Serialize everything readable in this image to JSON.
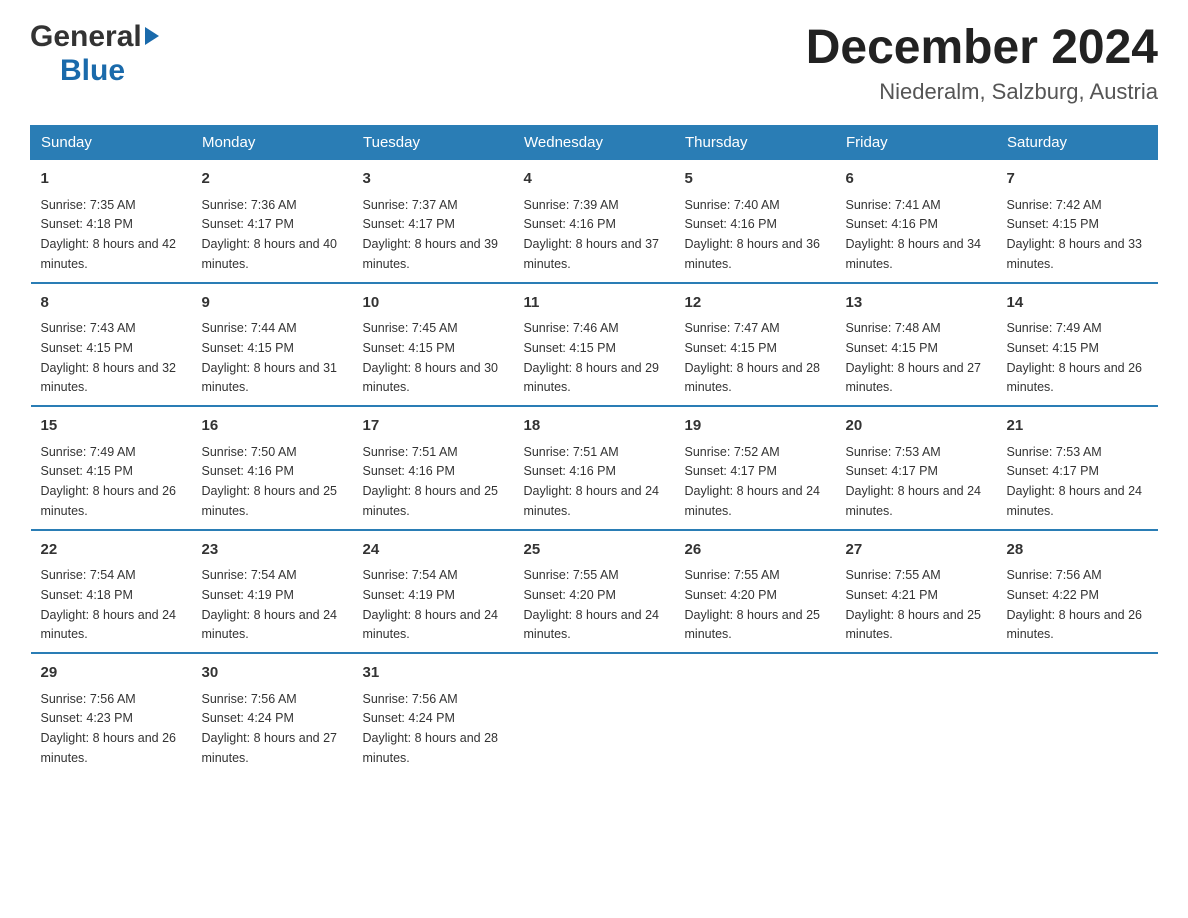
{
  "logo": {
    "general": "General",
    "blue": "Blue",
    "arrow_color": "#1a6aab"
  },
  "header": {
    "month_title": "December 2024",
    "location": "Niederalm, Salzburg, Austria"
  },
  "weekdays": [
    "Sunday",
    "Monday",
    "Tuesday",
    "Wednesday",
    "Thursday",
    "Friday",
    "Saturday"
  ],
  "weeks": [
    [
      {
        "day": "1",
        "sunrise": "Sunrise: 7:35 AM",
        "sunset": "Sunset: 4:18 PM",
        "daylight": "Daylight: 8 hours and 42 minutes."
      },
      {
        "day": "2",
        "sunrise": "Sunrise: 7:36 AM",
        "sunset": "Sunset: 4:17 PM",
        "daylight": "Daylight: 8 hours and 40 minutes."
      },
      {
        "day": "3",
        "sunrise": "Sunrise: 7:37 AM",
        "sunset": "Sunset: 4:17 PM",
        "daylight": "Daylight: 8 hours and 39 minutes."
      },
      {
        "day": "4",
        "sunrise": "Sunrise: 7:39 AM",
        "sunset": "Sunset: 4:16 PM",
        "daylight": "Daylight: 8 hours and 37 minutes."
      },
      {
        "day": "5",
        "sunrise": "Sunrise: 7:40 AM",
        "sunset": "Sunset: 4:16 PM",
        "daylight": "Daylight: 8 hours and 36 minutes."
      },
      {
        "day": "6",
        "sunrise": "Sunrise: 7:41 AM",
        "sunset": "Sunset: 4:16 PM",
        "daylight": "Daylight: 8 hours and 34 minutes."
      },
      {
        "day": "7",
        "sunrise": "Sunrise: 7:42 AM",
        "sunset": "Sunset: 4:15 PM",
        "daylight": "Daylight: 8 hours and 33 minutes."
      }
    ],
    [
      {
        "day": "8",
        "sunrise": "Sunrise: 7:43 AM",
        "sunset": "Sunset: 4:15 PM",
        "daylight": "Daylight: 8 hours and 32 minutes."
      },
      {
        "day": "9",
        "sunrise": "Sunrise: 7:44 AM",
        "sunset": "Sunset: 4:15 PM",
        "daylight": "Daylight: 8 hours and 31 minutes."
      },
      {
        "day": "10",
        "sunrise": "Sunrise: 7:45 AM",
        "sunset": "Sunset: 4:15 PM",
        "daylight": "Daylight: 8 hours and 30 minutes."
      },
      {
        "day": "11",
        "sunrise": "Sunrise: 7:46 AM",
        "sunset": "Sunset: 4:15 PM",
        "daylight": "Daylight: 8 hours and 29 minutes."
      },
      {
        "day": "12",
        "sunrise": "Sunrise: 7:47 AM",
        "sunset": "Sunset: 4:15 PM",
        "daylight": "Daylight: 8 hours and 28 minutes."
      },
      {
        "day": "13",
        "sunrise": "Sunrise: 7:48 AM",
        "sunset": "Sunset: 4:15 PM",
        "daylight": "Daylight: 8 hours and 27 minutes."
      },
      {
        "day": "14",
        "sunrise": "Sunrise: 7:49 AM",
        "sunset": "Sunset: 4:15 PM",
        "daylight": "Daylight: 8 hours and 26 minutes."
      }
    ],
    [
      {
        "day": "15",
        "sunrise": "Sunrise: 7:49 AM",
        "sunset": "Sunset: 4:15 PM",
        "daylight": "Daylight: 8 hours and 26 minutes."
      },
      {
        "day": "16",
        "sunrise": "Sunrise: 7:50 AM",
        "sunset": "Sunset: 4:16 PM",
        "daylight": "Daylight: 8 hours and 25 minutes."
      },
      {
        "day": "17",
        "sunrise": "Sunrise: 7:51 AM",
        "sunset": "Sunset: 4:16 PM",
        "daylight": "Daylight: 8 hours and 25 minutes."
      },
      {
        "day": "18",
        "sunrise": "Sunrise: 7:51 AM",
        "sunset": "Sunset: 4:16 PM",
        "daylight": "Daylight: 8 hours and 24 minutes."
      },
      {
        "day": "19",
        "sunrise": "Sunrise: 7:52 AM",
        "sunset": "Sunset: 4:17 PM",
        "daylight": "Daylight: 8 hours and 24 minutes."
      },
      {
        "day": "20",
        "sunrise": "Sunrise: 7:53 AM",
        "sunset": "Sunset: 4:17 PM",
        "daylight": "Daylight: 8 hours and 24 minutes."
      },
      {
        "day": "21",
        "sunrise": "Sunrise: 7:53 AM",
        "sunset": "Sunset: 4:17 PM",
        "daylight": "Daylight: 8 hours and 24 minutes."
      }
    ],
    [
      {
        "day": "22",
        "sunrise": "Sunrise: 7:54 AM",
        "sunset": "Sunset: 4:18 PM",
        "daylight": "Daylight: 8 hours and 24 minutes."
      },
      {
        "day": "23",
        "sunrise": "Sunrise: 7:54 AM",
        "sunset": "Sunset: 4:19 PM",
        "daylight": "Daylight: 8 hours and 24 minutes."
      },
      {
        "day": "24",
        "sunrise": "Sunrise: 7:54 AM",
        "sunset": "Sunset: 4:19 PM",
        "daylight": "Daylight: 8 hours and 24 minutes."
      },
      {
        "day": "25",
        "sunrise": "Sunrise: 7:55 AM",
        "sunset": "Sunset: 4:20 PM",
        "daylight": "Daylight: 8 hours and 24 minutes."
      },
      {
        "day": "26",
        "sunrise": "Sunrise: 7:55 AM",
        "sunset": "Sunset: 4:20 PM",
        "daylight": "Daylight: 8 hours and 25 minutes."
      },
      {
        "day": "27",
        "sunrise": "Sunrise: 7:55 AM",
        "sunset": "Sunset: 4:21 PM",
        "daylight": "Daylight: 8 hours and 25 minutes."
      },
      {
        "day": "28",
        "sunrise": "Sunrise: 7:56 AM",
        "sunset": "Sunset: 4:22 PM",
        "daylight": "Daylight: 8 hours and 26 minutes."
      }
    ],
    [
      {
        "day": "29",
        "sunrise": "Sunrise: 7:56 AM",
        "sunset": "Sunset: 4:23 PM",
        "daylight": "Daylight: 8 hours and 26 minutes."
      },
      {
        "day": "30",
        "sunrise": "Sunrise: 7:56 AM",
        "sunset": "Sunset: 4:24 PM",
        "daylight": "Daylight: 8 hours and 27 minutes."
      },
      {
        "day": "31",
        "sunrise": "Sunrise: 7:56 AM",
        "sunset": "Sunset: 4:24 PM",
        "daylight": "Daylight: 8 hours and 28 minutes."
      },
      {
        "day": "",
        "sunrise": "",
        "sunset": "",
        "daylight": ""
      },
      {
        "day": "",
        "sunrise": "",
        "sunset": "",
        "daylight": ""
      },
      {
        "day": "",
        "sunrise": "",
        "sunset": "",
        "daylight": ""
      },
      {
        "day": "",
        "sunrise": "",
        "sunset": "",
        "daylight": ""
      }
    ]
  ]
}
